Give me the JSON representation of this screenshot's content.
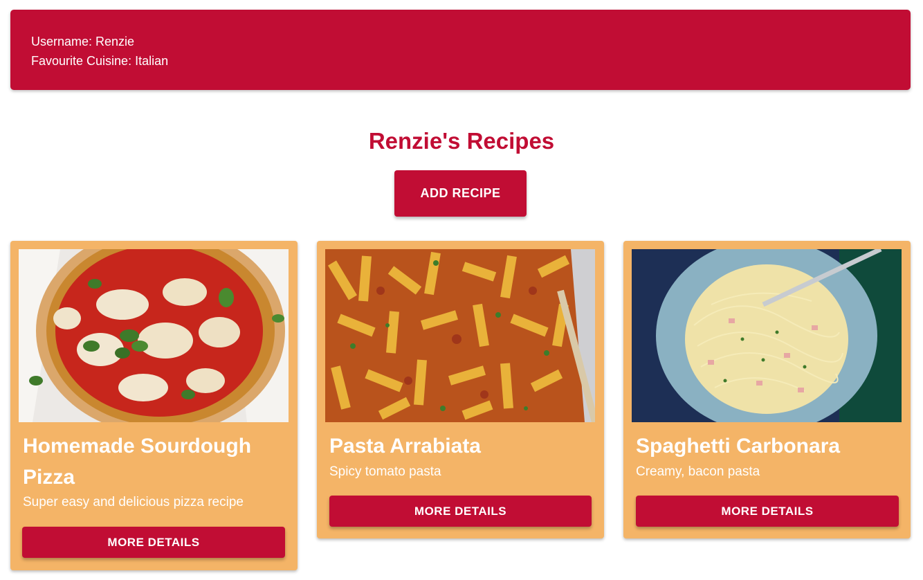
{
  "profile": {
    "username_line": "Username: Renzie",
    "cuisine_line": "Favourite Cuisine: Italian"
  },
  "page": {
    "title": "Renzie's Recipes",
    "add_button": "ADD RECIPE"
  },
  "colors": {
    "primary": "#c10d34",
    "card": "#f4b467",
    "text_on_primary": "#ffffff"
  },
  "recipes": [
    {
      "title": "Homemade Sourdough Pizza",
      "description": "Super easy and delicious pizza recipe",
      "button": "MORE DETAILS",
      "image": "pizza-photo"
    },
    {
      "title": "Pasta Arrabiata",
      "description": "Spicy tomato pasta",
      "button": "MORE DETAILS",
      "image": "penne-pasta-photo"
    },
    {
      "title": "Spaghetti Carbonara",
      "description": "Creamy, bacon pasta",
      "button": "MORE DETAILS",
      "image": "spaghetti-carbonara-photo"
    }
  ]
}
